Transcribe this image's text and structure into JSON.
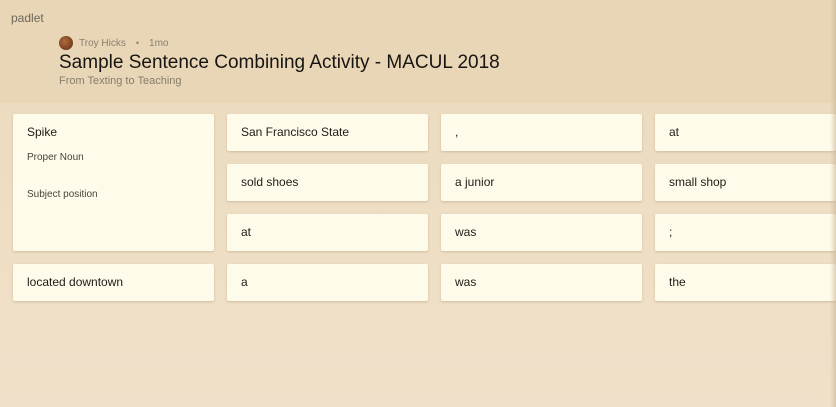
{
  "brand": "padlet",
  "author": {
    "name": "Troy Hicks",
    "separator": "•",
    "time": "1mo"
  },
  "title": "Sample Sentence Combining Activity - MACUL 2018",
  "subtitle": "From Texting to Teaching",
  "cards": {
    "spike": {
      "title": "Spike",
      "line1": "Proper Noun",
      "line2": "Subject position"
    },
    "located_downtown": "located downtown",
    "san_francisco_state": "San Francisco State",
    "comma": ",",
    "at_1": "at",
    "sold_shoes": "sold shoes",
    "a_junior": "a junior",
    "small_shop": "small shop",
    "at_2": "at",
    "was_1": "was",
    "semicolon": ";",
    "a": "a",
    "was_2": "was",
    "the": "the"
  }
}
